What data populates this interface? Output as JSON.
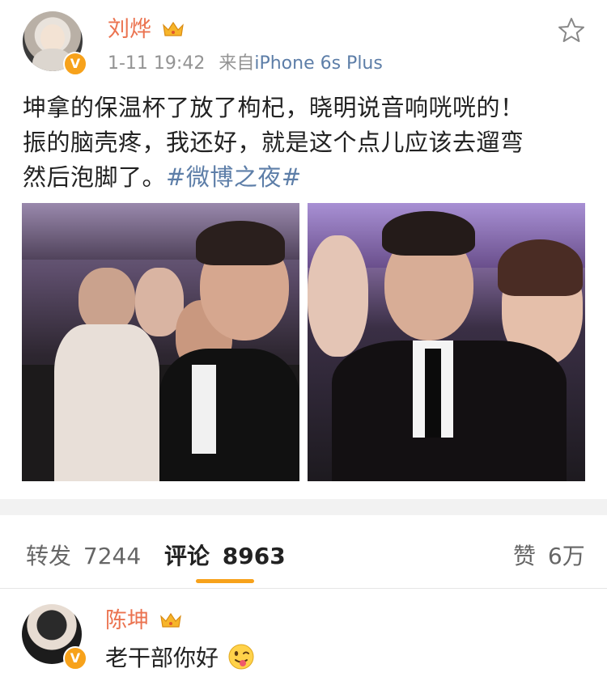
{
  "post": {
    "username": "刘烨",
    "timestamp": "1-11 19:42",
    "source_prefix": "来自",
    "source": "iPhone 6s Plus",
    "text_line1": "坤拿的保温杯了放了枸杞，晓明说音响咣咣的！",
    "text_line2": "振的脑壳疼，我还好，就是这个点儿应该去遛弯",
    "text_line3": "然后泡脚了。",
    "hashtag": "#微博之夜#",
    "verified_badge": "V",
    "icons": [
      "crown-icon",
      "favorite-star-icon",
      "verified-badge-icon"
    ]
  },
  "tabs": {
    "repost_label": "转发",
    "repost_count": "7244",
    "comment_label": "评论",
    "comment_count": "8963",
    "like_label": "赞",
    "like_count": "6万"
  },
  "comment": {
    "username": "陈坤",
    "text": "老干部你好",
    "verified_badge": "V"
  },
  "colors": {
    "username": "#eb7350",
    "link": "#5d7ea8",
    "accent": "#f7a21b",
    "meta": "#939393"
  }
}
